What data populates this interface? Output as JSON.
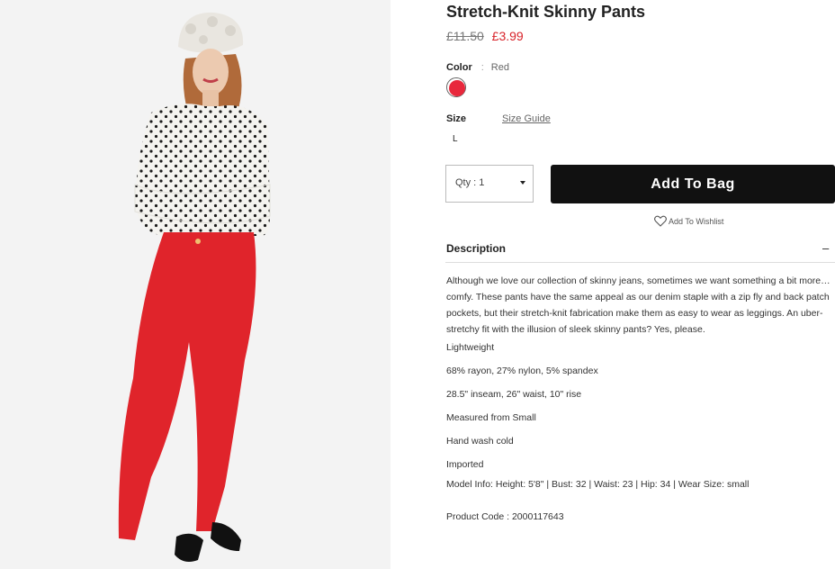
{
  "product": {
    "title": "Stretch-Knit Skinny Pants",
    "price_old": "£11.50",
    "price_new": "£3.99"
  },
  "color": {
    "label": "Color",
    "separator": ":",
    "value": "Red",
    "swatch_hex": "#e8283c"
  },
  "size": {
    "label": "Size",
    "guide_label": "Size Guide",
    "options": [
      "L"
    ]
  },
  "qty": {
    "label": "Qty : 1"
  },
  "actions": {
    "add_to_bag": "Add To Bag",
    "wishlist": "Add To Wishlist"
  },
  "description": {
    "heading": "Description",
    "toggle": "–",
    "paragraph": "Although we love our collection of skinny jeans, sometimes we want something a bit more… comfy. These pants have the same appeal as our denim staple with a zip fly and back patch pockets, but their stretch-knit fabrication make them as easy to wear as leggings. An uber-stretchy fit with the illusion of sleek skinny pants? Yes, please.",
    "features": [
      "Lightweight",
      "68% rayon, 27% nylon, 5% spandex",
      "28.5\" inseam, 26\" waist, 10\" rise",
      "Measured from Small",
      "Hand wash cold",
      "Imported",
      "Model Info: Height: 5'8\" | Bust: 32 | Waist: 23 | Hip: 34 | Wear Size: small"
    ],
    "product_code": "Product Code : 2000117643"
  },
  "colors": {
    "price_sale": "#d8232a",
    "button_bg": "#111111",
    "pants_red": "#e0242b"
  }
}
